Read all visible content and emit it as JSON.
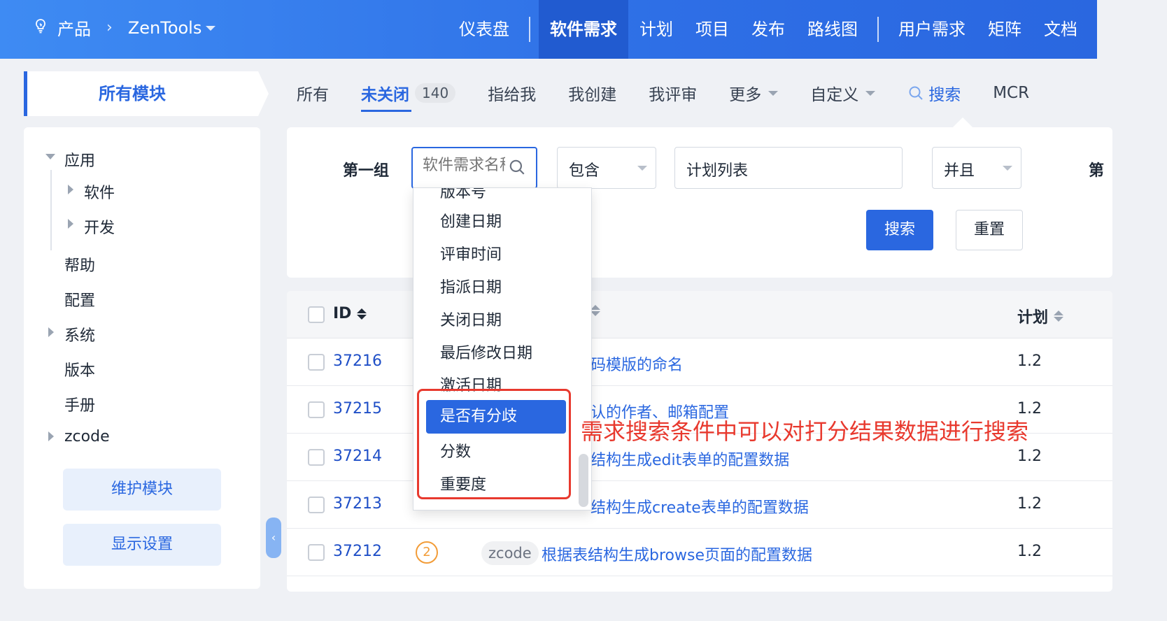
{
  "topbar": {
    "product_label": "产品",
    "product_name": "ZenTools",
    "nav": [
      "仪表盘",
      "软件需求",
      "计划",
      "项目",
      "发布",
      "路线图",
      "用户需求",
      "矩阵",
      "文档"
    ],
    "active_nav": "软件需求"
  },
  "sidebar": {
    "module_tab": "所有模块",
    "tree": [
      "应用",
      "软件",
      "开发",
      "帮助",
      "配置",
      "系统",
      "版本",
      "手册",
      "zcode"
    ],
    "maintain_button": "维护模块",
    "display_button": "显示设置"
  },
  "subtabs": {
    "all": "所有",
    "unclosed": "未关闭",
    "unclosed_count": "140",
    "assigned": "指给我",
    "created": "我创建",
    "reviewed": "我评审",
    "more": "更多",
    "custom": "自定义",
    "search": "搜索",
    "mcr": "MCR"
  },
  "search": {
    "group_label": "第一组",
    "field_placeholder": "软件需求名称",
    "operator": "包含",
    "value": "计划列表",
    "logic": "并且",
    "cut_text": "第",
    "search_button": "搜索",
    "reset_button": "重置"
  },
  "dropdown": {
    "partial_top": "版本号",
    "items": [
      "创建日期",
      "评审时间",
      "指派日期",
      "关闭日期",
      "最后修改日期",
      "激活日期"
    ],
    "highlight_items": [
      "是否有分歧",
      "分数",
      "重要度"
    ],
    "selected": "是否有分歧"
  },
  "annotation": "需求搜索条件中可以对打分结果数据进行搜索",
  "table": {
    "columns": {
      "id": "ID",
      "plan": "计划"
    },
    "rows": [
      {
        "id": "37216",
        "title": "码模版的命名",
        "plan": "1.2"
      },
      {
        "id": "37215",
        "title": "认的作者、邮箱配置",
        "plan": "1.2"
      },
      {
        "id": "37214",
        "title": "结构生成edit表单的配置数据",
        "plan": "1.2"
      },
      {
        "id": "37213",
        "title": "结构生成create表单的配置数据",
        "plan": "1.2"
      },
      {
        "id": "37212",
        "pri": "2",
        "tag": "zcode",
        "title": "根据表结构生成browse页面的配置数据",
        "plan": "1.2"
      }
    ]
  },
  "colors": {
    "brand": "#2a67e0",
    "accent_red": "#e8392e",
    "priority": "#f29c38"
  }
}
